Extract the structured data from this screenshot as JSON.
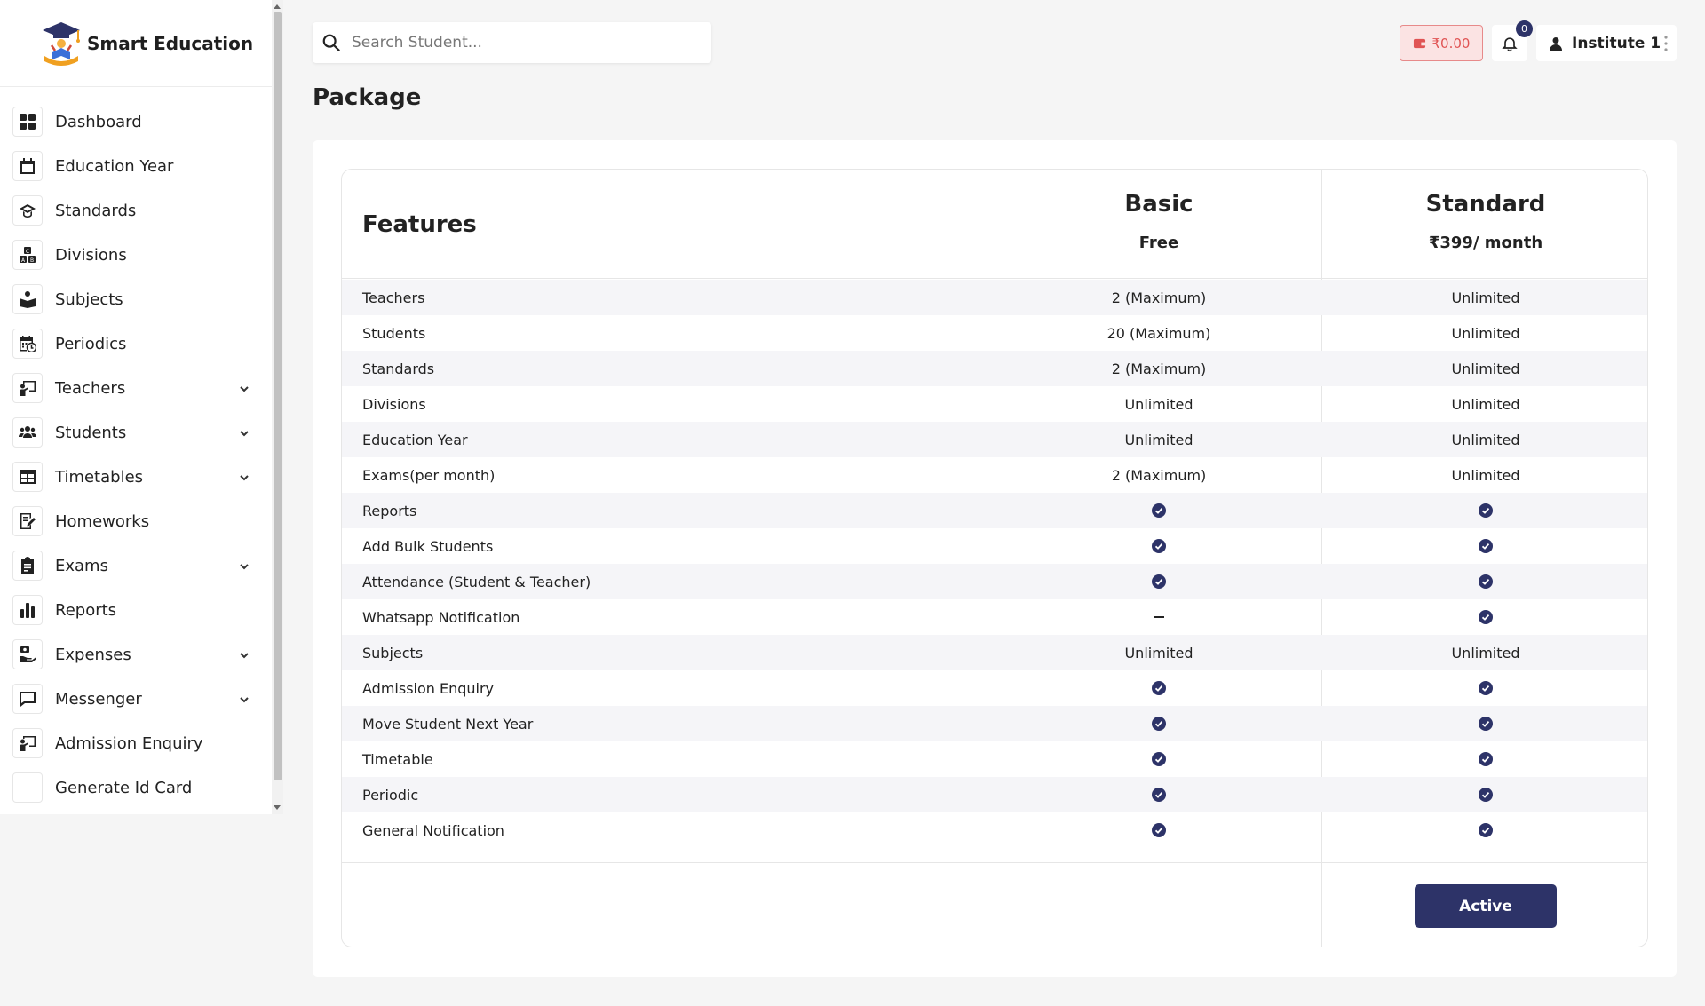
{
  "brand": {
    "name": "Smart Education"
  },
  "sidebar": {
    "items": [
      {
        "label": "Dashboard",
        "icon": "grid-icon",
        "expandable": false
      },
      {
        "label": "Education Year",
        "icon": "calendar-icon",
        "expandable": false
      },
      {
        "label": "Standards",
        "icon": "graduation-cap-icon",
        "expandable": false
      },
      {
        "label": "Divisions",
        "icon": "blocks-icon",
        "expandable": false
      },
      {
        "label": "Subjects",
        "icon": "book-reader-icon",
        "expandable": false
      },
      {
        "label": "Periodics",
        "icon": "calendar-clock-icon",
        "expandable": false
      },
      {
        "label": "Teachers",
        "icon": "chalkboard-teacher-icon",
        "expandable": true
      },
      {
        "label": "Students",
        "icon": "users-icon",
        "expandable": true
      },
      {
        "label": "Timetables",
        "icon": "table-icon",
        "expandable": true
      },
      {
        "label": "Homeworks",
        "icon": "notebook-pen-icon",
        "expandable": false
      },
      {
        "label": "Exams",
        "icon": "clipboard-icon",
        "expandable": true
      },
      {
        "label": "Reports",
        "icon": "bar-chart-icon",
        "expandable": false
      },
      {
        "label": "Expenses",
        "icon": "hand-money-icon",
        "expandable": true
      },
      {
        "label": "Messenger",
        "icon": "message-icon",
        "expandable": true
      },
      {
        "label": "Admission Enquiry",
        "icon": "chalkboard-teacher-icon",
        "expandable": false
      },
      {
        "label": "Generate Id Card",
        "icon": "",
        "expandable": false
      }
    ]
  },
  "header": {
    "search_placeholder": "Search Student...",
    "wallet_amount": "₹0.00",
    "notification_count": "0",
    "user_name": "Institute 1"
  },
  "page": {
    "title": "Package"
  },
  "pricing": {
    "features_heading": "Features",
    "plans": [
      {
        "name": "Basic",
        "price": "Free"
      },
      {
        "name": "Standard",
        "price": "₹399/ month"
      }
    ],
    "rows": [
      {
        "feature": "Teachers",
        "basic": "2 (Maximum)",
        "standard": "Unlimited"
      },
      {
        "feature": "Students",
        "basic": "20 (Maximum)",
        "standard": "Unlimited"
      },
      {
        "feature": "Standards",
        "basic": "2 (Maximum)",
        "standard": "Unlimited"
      },
      {
        "feature": "Divisions",
        "basic": "Unlimited",
        "standard": "Unlimited"
      },
      {
        "feature": "Education Year",
        "basic": "Unlimited",
        "standard": "Unlimited"
      },
      {
        "feature": "Exams(per month)",
        "basic": "2 (Maximum)",
        "standard": "Unlimited"
      },
      {
        "feature": "Reports",
        "basic": "check",
        "standard": "check"
      },
      {
        "feature": "Add Bulk Students",
        "basic": "check",
        "standard": "check"
      },
      {
        "feature": "Attendance (Student & Teacher)",
        "basic": "check",
        "standard": "check"
      },
      {
        "feature": "Whatsapp Notification",
        "basic": "dash",
        "standard": "check"
      },
      {
        "feature": "Subjects",
        "basic": "Unlimited",
        "standard": "Unlimited"
      },
      {
        "feature": "Admission Enquiry",
        "basic": "check",
        "standard": "check"
      },
      {
        "feature": "Move Student Next Year",
        "basic": "check",
        "standard": "check"
      },
      {
        "feature": "Timetable",
        "basic": "check",
        "standard": "check"
      },
      {
        "feature": "Periodic",
        "basic": "check",
        "standard": "check"
      },
      {
        "feature": "General Notification",
        "basic": "check",
        "standard": "check"
      }
    ],
    "active_label": "Active"
  },
  "colors": {
    "primary": "#2d3368",
    "wallet_text": "#e05353",
    "wallet_bg": "#fbe3e3",
    "row_alt": "#f5f5f8"
  }
}
